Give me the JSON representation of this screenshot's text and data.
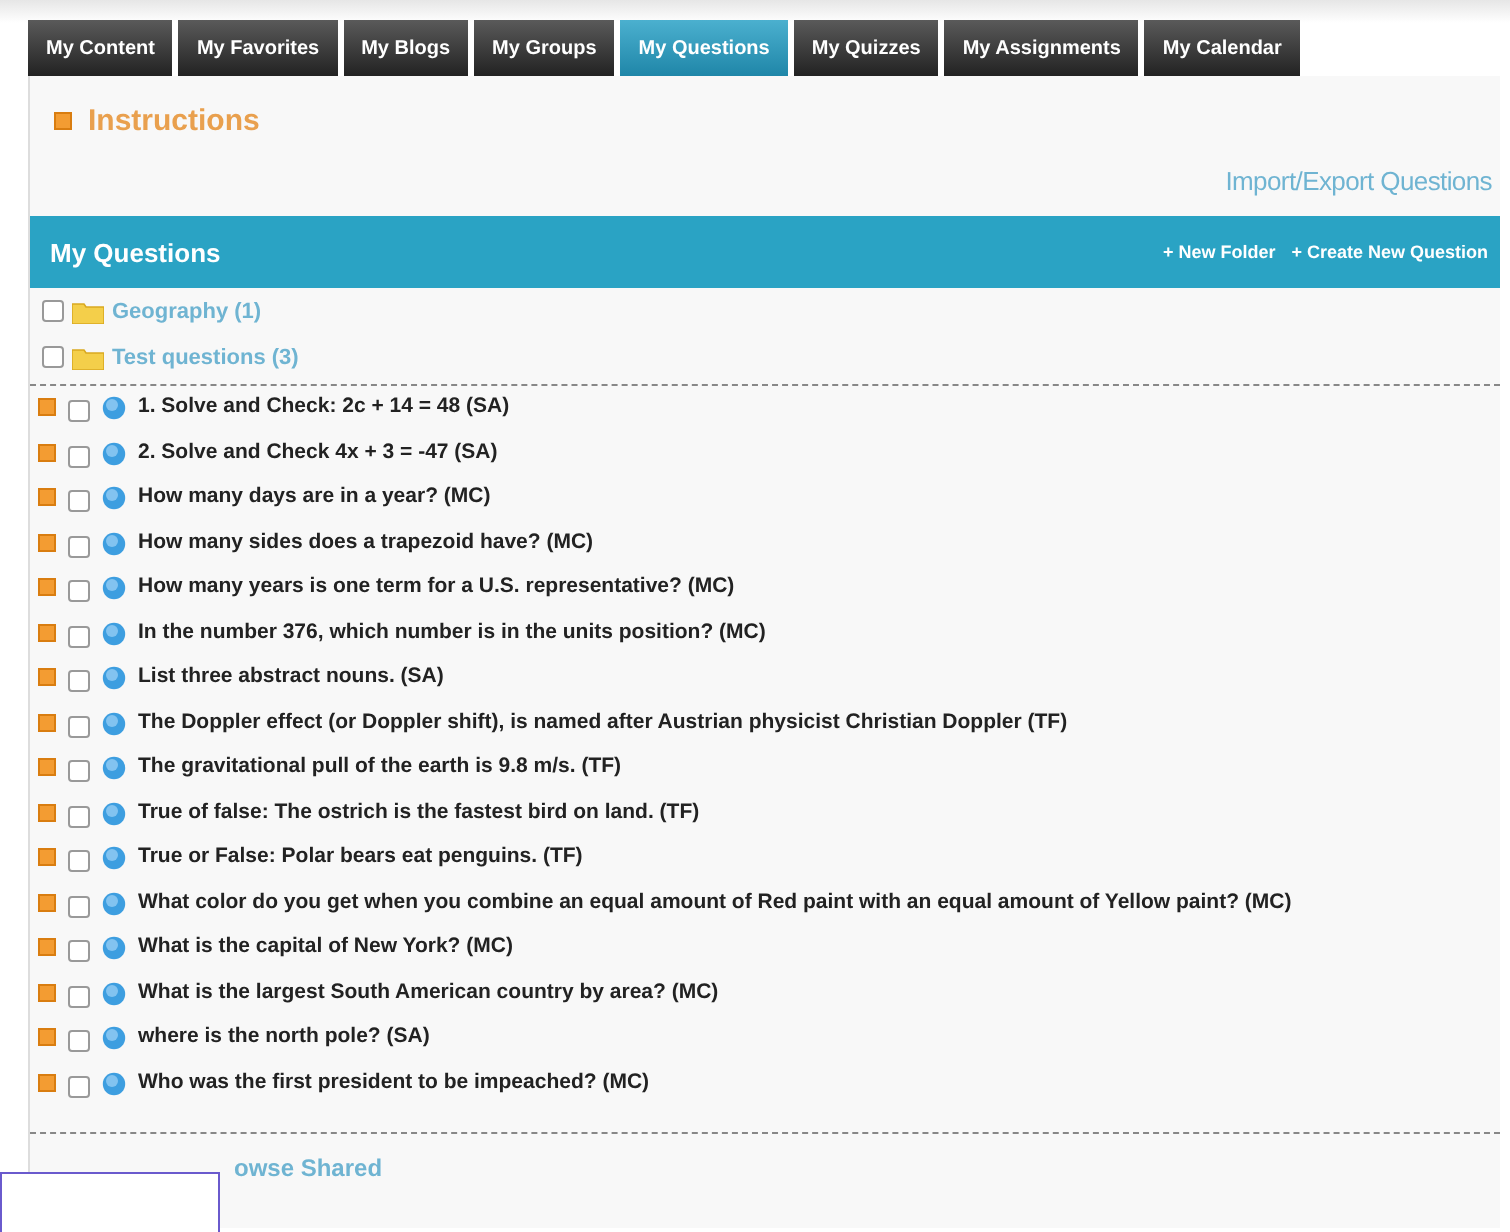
{
  "tabs": [
    {
      "label": "My Content",
      "selected": false
    },
    {
      "label": "My Favorites",
      "selected": false
    },
    {
      "label": "My Blogs",
      "selected": false
    },
    {
      "label": "My Groups",
      "selected": false
    },
    {
      "label": "My Questions",
      "selected": true
    },
    {
      "label": "My Quizzes",
      "selected": false
    },
    {
      "label": "My Assignments",
      "selected": false
    },
    {
      "label": "My Calendar",
      "selected": false
    }
  ],
  "instructions": {
    "title": "Instructions"
  },
  "import_export_link": "Import/Export Questions",
  "panel": {
    "title": "My Questions",
    "actions": [
      "+ New Folder",
      "+ Create New Question"
    ]
  },
  "folders": [
    {
      "name": "Geography (1)",
      "checked": false
    },
    {
      "name": "Test questions (3)",
      "checked": false
    }
  ],
  "questions": [
    {
      "text": "1. Solve and Check: 2c + 14 = 48 (SA)",
      "checked": false
    },
    {
      "text": "2. Solve and Check 4x + 3 = -47 (SA)",
      "checked": false
    },
    {
      "text": "How many days are in a year? (MC)",
      "checked": false
    },
    {
      "text": "How many sides does a trapezoid have? (MC)",
      "checked": false
    },
    {
      "text": "How many years is one term for a U.S. representative? (MC)",
      "checked": false
    },
    {
      "text": "In the number 376, which number is in the units position? (MC)",
      "checked": false
    },
    {
      "text": "List three abstract nouns. (SA)",
      "checked": false
    },
    {
      "text": "The Doppler effect (or Doppler shift), is named after Austrian physicist Christian Doppler (TF)",
      "checked": false
    },
    {
      "text": "The gravitational pull of the earth is 9.8 m/s. (TF)",
      "checked": false
    },
    {
      "text": "True of false: The ostrich is the fastest bird on land. (TF)",
      "checked": false
    },
    {
      "text": "True or False: Polar bears eat penguins. (TF)",
      "checked": false
    },
    {
      "text": "What color do you get when you combine an equal amount of Red paint with an equal amount of Yellow paint? (MC)",
      "checked": false
    },
    {
      "text": "What is the capital of New York? (MC)",
      "checked": false
    },
    {
      "text": "What is the largest South American country by area? (MC)",
      "checked": false
    },
    {
      "text": "where is the north pole? (SA)",
      "checked": false
    },
    {
      "text": "Who was the first president to be impeached? (MC)",
      "checked": false
    }
  ],
  "browse_shared": "owse Shared"
}
